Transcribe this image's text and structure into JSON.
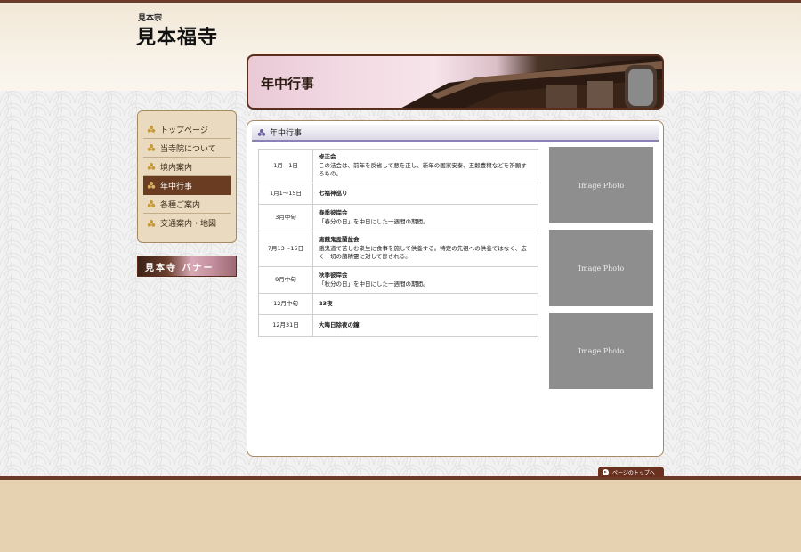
{
  "site": {
    "sect": "見本宗",
    "name": "見本福寺"
  },
  "hero": {
    "title": "年中行事"
  },
  "sidebar": {
    "items": [
      {
        "label": "トップページ",
        "active": false
      },
      {
        "label": "当寺院について",
        "active": false
      },
      {
        "label": "境内案内",
        "active": false
      },
      {
        "label": "年中行事",
        "active": true
      },
      {
        "label": "各種ご案内",
        "active": false
      },
      {
        "label": "交通案内・地図",
        "active": false
      }
    ],
    "banner_label": "見本寺 バナー"
  },
  "main": {
    "heading": "年中行事",
    "events": [
      {
        "date": "1月　1日",
        "title": "修正会",
        "desc": "この法会は、前年を反省して悪を正し、新年の国家安泰、五穀豊穣などを祈願するもの。"
      },
      {
        "date": "1月1～15日",
        "title": "七福神巡り",
        "desc": ""
      },
      {
        "date": "3月中旬",
        "title": "春季彼岸会",
        "desc": "「春分の日」を中日にした一週間の期間。"
      },
      {
        "date": "7月13～15日",
        "title": "施餓鬼盂蘭盆会",
        "desc": "餓鬼道で苦しむ衆生に食事を施して供養する。特定の先祖への供養ではなく、広く一切の諸精霊に対して修される。"
      },
      {
        "date": "9月中旬",
        "title": "秋季彼岸会",
        "desc": "「秋分の日」を中日にした一週間の期間。"
      },
      {
        "date": "12月中旬",
        "title": "23夜",
        "desc": ""
      },
      {
        "date": "12月31日",
        "title": "大晦日除夜の鐘",
        "desc": ""
      }
    ],
    "photos": [
      "Image Photo",
      "Image Photo",
      "Image Photo"
    ]
  },
  "footer": {
    "page_top": "ページのトップへ"
  },
  "colors": {
    "accent_brown": "#6a3d22",
    "heading_rule": "#8a82b4",
    "photo_gray": "#8e8e8e"
  }
}
